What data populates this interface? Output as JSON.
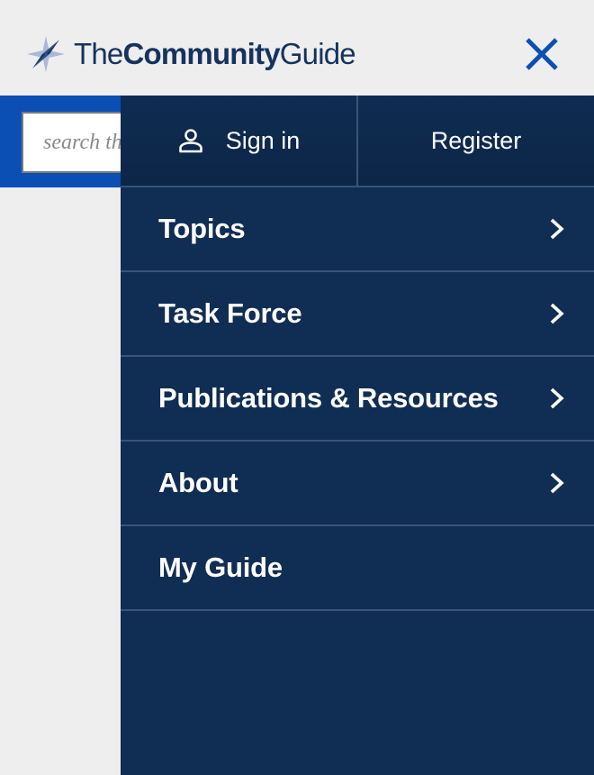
{
  "header": {
    "logo": {
      "word1": "The",
      "word2": "Community",
      "word3": "Guide",
      "icon": "star-compass-icon"
    },
    "close_icon": "close-icon"
  },
  "search": {
    "placeholder": "search the site"
  },
  "drawer": {
    "auth": {
      "signin_label": "Sign in",
      "signin_icon": "person-icon",
      "register_label": "Register"
    },
    "nav": [
      {
        "label": "Topics",
        "has_submenu": true
      },
      {
        "label": "Task Force",
        "has_submenu": true
      },
      {
        "label": "Publications & Resources",
        "has_submenu": true
      },
      {
        "label": "About",
        "has_submenu": true
      },
      {
        "label": "My Guide",
        "has_submenu": false
      }
    ]
  },
  "colors": {
    "brand_navy": "#16335f",
    "drawer_bg": "#102d53",
    "search_band": "#0b4fb5",
    "close_blue": "#0b4fb5",
    "divider": "#3a5478",
    "page_bg": "#eeeeee"
  }
}
